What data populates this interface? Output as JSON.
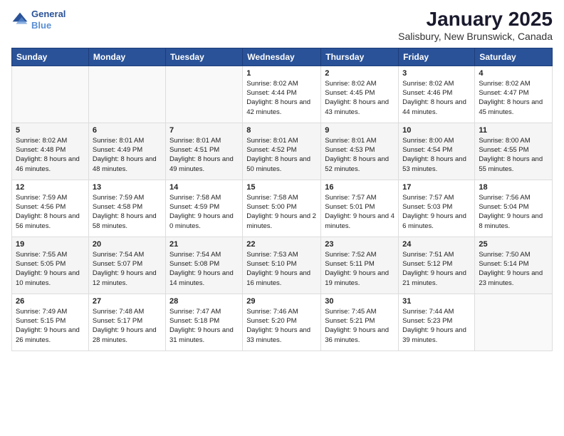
{
  "logo": {
    "line1": "General",
    "line2": "Blue"
  },
  "title": "January 2025",
  "subtitle": "Salisbury, New Brunswick, Canada",
  "days": [
    "Sunday",
    "Monday",
    "Tuesday",
    "Wednesday",
    "Thursday",
    "Friday",
    "Saturday"
  ],
  "weeks": [
    [
      {
        "day": "",
        "sunrise": "",
        "sunset": "",
        "daylight": ""
      },
      {
        "day": "",
        "sunrise": "",
        "sunset": "",
        "daylight": ""
      },
      {
        "day": "",
        "sunrise": "",
        "sunset": "",
        "daylight": ""
      },
      {
        "day": "1",
        "sunrise": "Sunrise: 8:02 AM",
        "sunset": "Sunset: 4:44 PM",
        "daylight": "Daylight: 8 hours and 42 minutes."
      },
      {
        "day": "2",
        "sunrise": "Sunrise: 8:02 AM",
        "sunset": "Sunset: 4:45 PM",
        "daylight": "Daylight: 8 hours and 43 minutes."
      },
      {
        "day": "3",
        "sunrise": "Sunrise: 8:02 AM",
        "sunset": "Sunset: 4:46 PM",
        "daylight": "Daylight: 8 hours and 44 minutes."
      },
      {
        "day": "4",
        "sunrise": "Sunrise: 8:02 AM",
        "sunset": "Sunset: 4:47 PM",
        "daylight": "Daylight: 8 hours and 45 minutes."
      }
    ],
    [
      {
        "day": "5",
        "sunrise": "Sunrise: 8:02 AM",
        "sunset": "Sunset: 4:48 PM",
        "daylight": "Daylight: 8 hours and 46 minutes."
      },
      {
        "day": "6",
        "sunrise": "Sunrise: 8:01 AM",
        "sunset": "Sunset: 4:49 PM",
        "daylight": "Daylight: 8 hours and 48 minutes."
      },
      {
        "day": "7",
        "sunrise": "Sunrise: 8:01 AM",
        "sunset": "Sunset: 4:51 PM",
        "daylight": "Daylight: 8 hours and 49 minutes."
      },
      {
        "day": "8",
        "sunrise": "Sunrise: 8:01 AM",
        "sunset": "Sunset: 4:52 PM",
        "daylight": "Daylight: 8 hours and 50 minutes."
      },
      {
        "day": "9",
        "sunrise": "Sunrise: 8:01 AM",
        "sunset": "Sunset: 4:53 PM",
        "daylight": "Daylight: 8 hours and 52 minutes."
      },
      {
        "day": "10",
        "sunrise": "Sunrise: 8:00 AM",
        "sunset": "Sunset: 4:54 PM",
        "daylight": "Daylight: 8 hours and 53 minutes."
      },
      {
        "day": "11",
        "sunrise": "Sunrise: 8:00 AM",
        "sunset": "Sunset: 4:55 PM",
        "daylight": "Daylight: 8 hours and 55 minutes."
      }
    ],
    [
      {
        "day": "12",
        "sunrise": "Sunrise: 7:59 AM",
        "sunset": "Sunset: 4:56 PM",
        "daylight": "Daylight: 8 hours and 56 minutes."
      },
      {
        "day": "13",
        "sunrise": "Sunrise: 7:59 AM",
        "sunset": "Sunset: 4:58 PM",
        "daylight": "Daylight: 8 hours and 58 minutes."
      },
      {
        "day": "14",
        "sunrise": "Sunrise: 7:58 AM",
        "sunset": "Sunset: 4:59 PM",
        "daylight": "Daylight: 9 hours and 0 minutes."
      },
      {
        "day": "15",
        "sunrise": "Sunrise: 7:58 AM",
        "sunset": "Sunset: 5:00 PM",
        "daylight": "Daylight: 9 hours and 2 minutes."
      },
      {
        "day": "16",
        "sunrise": "Sunrise: 7:57 AM",
        "sunset": "Sunset: 5:01 PM",
        "daylight": "Daylight: 9 hours and 4 minutes."
      },
      {
        "day": "17",
        "sunrise": "Sunrise: 7:57 AM",
        "sunset": "Sunset: 5:03 PM",
        "daylight": "Daylight: 9 hours and 6 minutes."
      },
      {
        "day": "18",
        "sunrise": "Sunrise: 7:56 AM",
        "sunset": "Sunset: 5:04 PM",
        "daylight": "Daylight: 9 hours and 8 minutes."
      }
    ],
    [
      {
        "day": "19",
        "sunrise": "Sunrise: 7:55 AM",
        "sunset": "Sunset: 5:05 PM",
        "daylight": "Daylight: 9 hours and 10 minutes."
      },
      {
        "day": "20",
        "sunrise": "Sunrise: 7:54 AM",
        "sunset": "Sunset: 5:07 PM",
        "daylight": "Daylight: 9 hours and 12 minutes."
      },
      {
        "day": "21",
        "sunrise": "Sunrise: 7:54 AM",
        "sunset": "Sunset: 5:08 PM",
        "daylight": "Daylight: 9 hours and 14 minutes."
      },
      {
        "day": "22",
        "sunrise": "Sunrise: 7:53 AM",
        "sunset": "Sunset: 5:10 PM",
        "daylight": "Daylight: 9 hours and 16 minutes."
      },
      {
        "day": "23",
        "sunrise": "Sunrise: 7:52 AM",
        "sunset": "Sunset: 5:11 PM",
        "daylight": "Daylight: 9 hours and 19 minutes."
      },
      {
        "day": "24",
        "sunrise": "Sunrise: 7:51 AM",
        "sunset": "Sunset: 5:12 PM",
        "daylight": "Daylight: 9 hours and 21 minutes."
      },
      {
        "day": "25",
        "sunrise": "Sunrise: 7:50 AM",
        "sunset": "Sunset: 5:14 PM",
        "daylight": "Daylight: 9 hours and 23 minutes."
      }
    ],
    [
      {
        "day": "26",
        "sunrise": "Sunrise: 7:49 AM",
        "sunset": "Sunset: 5:15 PM",
        "daylight": "Daylight: 9 hours and 26 minutes."
      },
      {
        "day": "27",
        "sunrise": "Sunrise: 7:48 AM",
        "sunset": "Sunset: 5:17 PM",
        "daylight": "Daylight: 9 hours and 28 minutes."
      },
      {
        "day": "28",
        "sunrise": "Sunrise: 7:47 AM",
        "sunset": "Sunset: 5:18 PM",
        "daylight": "Daylight: 9 hours and 31 minutes."
      },
      {
        "day": "29",
        "sunrise": "Sunrise: 7:46 AM",
        "sunset": "Sunset: 5:20 PM",
        "daylight": "Daylight: 9 hours and 33 minutes."
      },
      {
        "day": "30",
        "sunrise": "Sunrise: 7:45 AM",
        "sunset": "Sunset: 5:21 PM",
        "daylight": "Daylight: 9 hours and 36 minutes."
      },
      {
        "day": "31",
        "sunrise": "Sunrise: 7:44 AM",
        "sunset": "Sunset: 5:23 PM",
        "daylight": "Daylight: 9 hours and 39 minutes."
      },
      {
        "day": "",
        "sunrise": "",
        "sunset": "",
        "daylight": ""
      }
    ]
  ]
}
